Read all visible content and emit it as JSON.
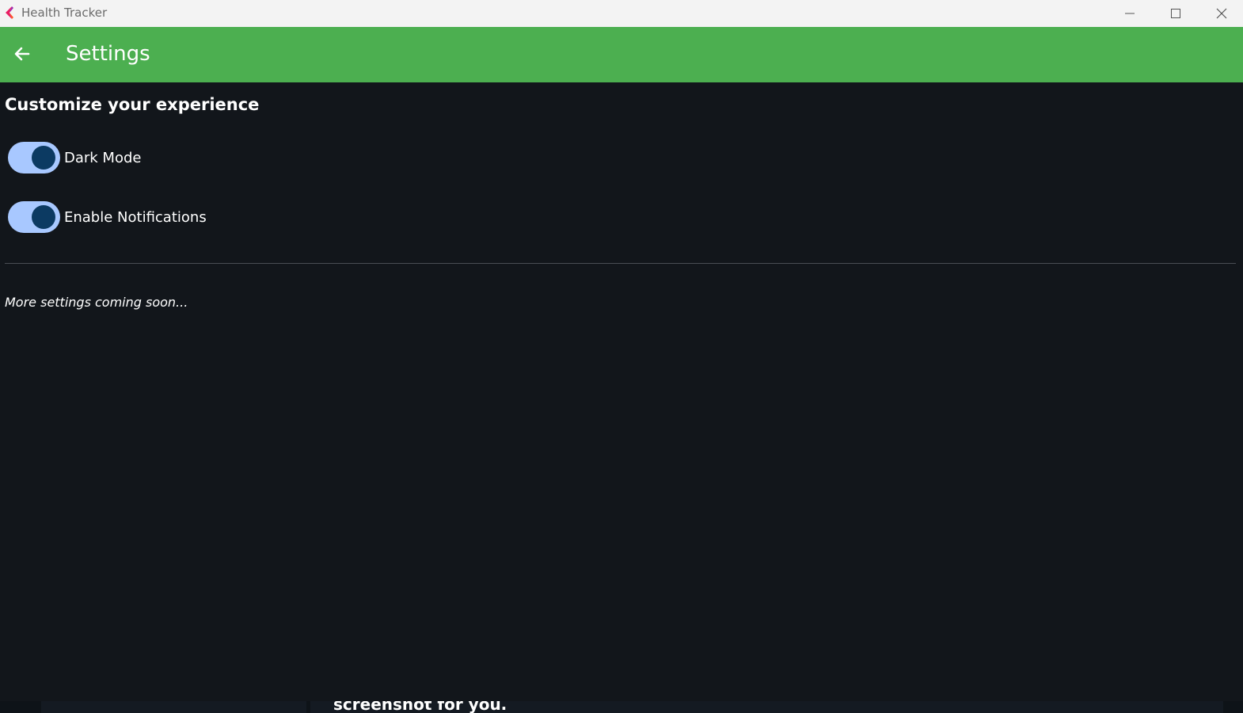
{
  "window": {
    "title": "Health Tracker",
    "icon": "app-logo-icon",
    "controls": [
      "minimize-icon",
      "maximize-icon",
      "close-icon"
    ]
  },
  "appbar": {
    "title": "Settings",
    "back_icon": "arrow-left-icon",
    "color": "#4caf50"
  },
  "content": {
    "heading": "Customize your experience",
    "settings": [
      {
        "label": "Dark Mode",
        "enabled": true
      },
      {
        "label": "Enable Notifications",
        "enabled": true
      }
    ],
    "note": "More settings coming soon..."
  },
  "background_overlay": {
    "text": "screenshot for you."
  },
  "colors": {
    "background": "#12161b",
    "switch_track": "#a8c8ff",
    "switch_thumb": "#0c3a62"
  }
}
